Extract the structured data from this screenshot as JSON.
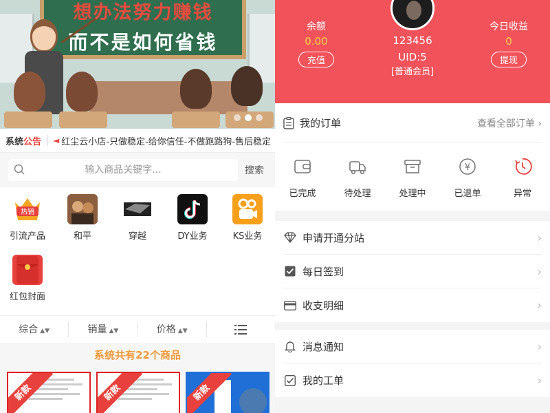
{
  "banner": {
    "line1": "想办法努力赚钱",
    "line2": "而不是如何省钱",
    "dots": 3,
    "active_dot": 2
  },
  "notice": {
    "label_part1": "系统",
    "label_part2": "公告",
    "text": "红尘云小店-只做稳定-给你信任-不做跑路狗-售后稳定"
  },
  "search": {
    "placeholder": "输入商品关键字...",
    "button": "搜索"
  },
  "categories": [
    {
      "label": "引流产品",
      "icon": "hot-sale-icon"
    },
    {
      "label": "和平",
      "icon": "game-peace-icon"
    },
    {
      "label": "穿越",
      "icon": "game-crossfire-icon"
    },
    {
      "label": "DY业务",
      "icon": "tiktok-icon"
    },
    {
      "label": "KS业务",
      "icon": "kuaishou-icon"
    },
    {
      "label": "红包封面",
      "icon": "red-envelope-icon"
    }
  ],
  "sort": {
    "items": [
      "综合",
      "销量",
      "价格"
    ],
    "list_icon": "list-view-icon"
  },
  "total": {
    "prefix": "系统共有",
    "count": "22",
    "suffix": "个商品"
  },
  "products": [
    {
      "badge": "新款"
    },
    {
      "badge": "新款"
    },
    {
      "badge": "新款"
    }
  ],
  "profile": {
    "balance_label": "余额",
    "balance_value": "0.00",
    "recharge_button": "充值",
    "today_label": "今日收益",
    "today_value": "0",
    "withdraw_button": "提现",
    "username": "123456",
    "uid": "UID:5",
    "level": "[普通会员]"
  },
  "orders": {
    "title": "我的订单",
    "view_all": "查看全部订单",
    "items": [
      {
        "label": "已完成",
        "icon": "wallet-icon"
      },
      {
        "label": "待处理",
        "icon": "truck-icon"
      },
      {
        "label": "处理中",
        "icon": "box-icon"
      },
      {
        "label": "已退单",
        "icon": "yen-icon"
      },
      {
        "label": "异常",
        "icon": "clock-icon"
      }
    ]
  },
  "menu_group1": [
    {
      "label": "申请开通分站",
      "icon": "diamond-icon"
    },
    {
      "label": "每日签到",
      "icon": "checkbox-icon"
    },
    {
      "label": "收支明细",
      "icon": "card-icon"
    }
  ],
  "menu_group2": [
    {
      "label": "消息通知",
      "icon": "bell-icon"
    },
    {
      "label": "我的工单",
      "icon": "ticket-check-icon"
    }
  ],
  "colors": {
    "accent_red": "#f2525a",
    "orange": "#f29a3a",
    "yellow_value": "#f7d34a"
  }
}
